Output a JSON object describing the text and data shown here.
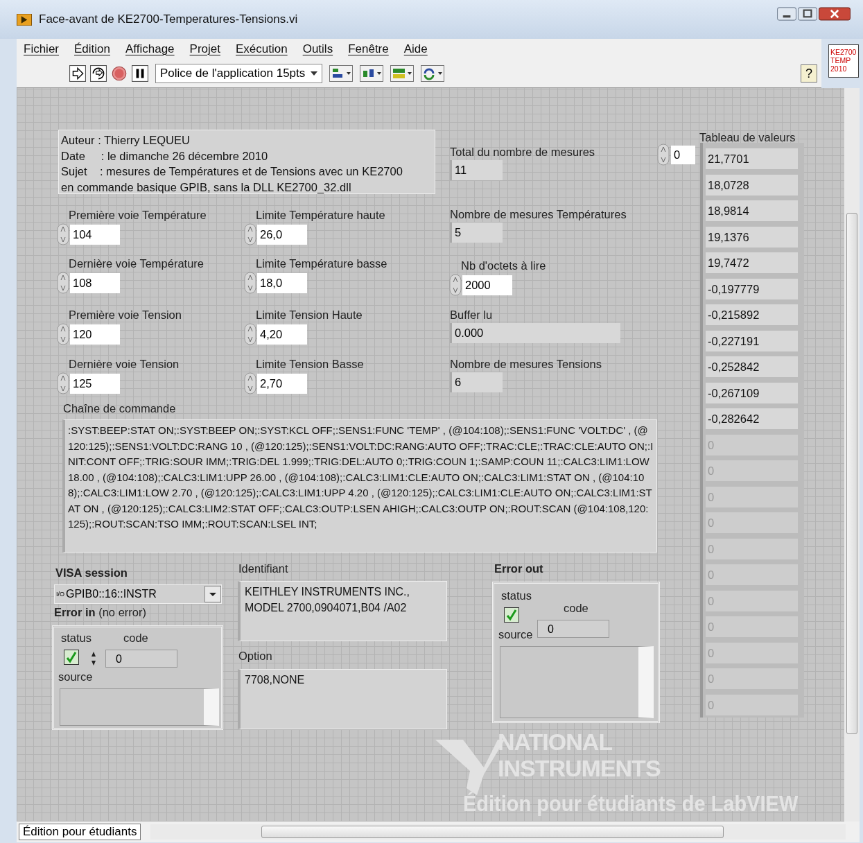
{
  "window": {
    "title": "Face-avant de KE2700-Temperatures-Tensions.vi"
  },
  "menu": [
    "Fichier",
    "Édition",
    "Affichage",
    "Projet",
    "Exécution",
    "Outils",
    "Fenêtre",
    "Aide"
  ],
  "toolbar": {
    "font": "Police de l'application 15pts",
    "help": "?",
    "vi_icon": [
      "KE2700",
      "TEMP",
      "2010"
    ]
  },
  "comment": [
    "Auteur : Thierry LEQUEU",
    "Date     : le dimanche 26 décembre 2010",
    "Sujet    : mesures de Températures et de Tensions avec un KE2700",
    "en commande basique GPIB, sans la DLL KE2700_32.dll"
  ],
  "numerics": [
    {
      "label": "Première voie Température",
      "value": "104",
      "kind": "control"
    },
    {
      "label": "Dernière voie Température",
      "value": "108",
      "kind": "control"
    },
    {
      "label": "Première voie Tension",
      "value": "120",
      "kind": "control"
    },
    {
      "label": "Dernière voie Tension",
      "value": "125",
      "kind": "control"
    },
    {
      "label": "Limite Température haute",
      "value": "26,0",
      "kind": "control"
    },
    {
      "label": "Limite Température basse",
      "value": "18,0",
      "kind": "control"
    },
    {
      "label": "Limite Tension Haute",
      "value": "4,20",
      "kind": "control"
    },
    {
      "label": "Limite Tension Basse",
      "value": "2,70",
      "kind": "control"
    },
    {
      "label": "Total du nombre de mesures",
      "value": "11",
      "kind": "indicator"
    },
    {
      "label": "Nombre de mesures Températures",
      "value": "5",
      "kind": "indicator"
    },
    {
      "label": "Nb d'octets à lire",
      "value": "2000",
      "kind": "control"
    },
    {
      "label": "Buffer lu",
      "value": "0.000",
      "kind": "string"
    },
    {
      "label": "Nombre de mesures Tensions",
      "value": "6",
      "kind": "indicator"
    }
  ],
  "array": {
    "label": "Tableau de valeurs",
    "index": "0",
    "items": [
      {
        "value": "21,7701",
        "disabled": false
      },
      {
        "value": "18,0728",
        "disabled": false
      },
      {
        "value": "18,9814",
        "disabled": false
      },
      {
        "value": "19,1376",
        "disabled": false
      },
      {
        "value": "19,7472",
        "disabled": false
      },
      {
        "value": "-0,197779",
        "disabled": false
      },
      {
        "value": "-0,215892",
        "disabled": false
      },
      {
        "value": "-0,227191",
        "disabled": false
      },
      {
        "value": "-0,252842",
        "disabled": false
      },
      {
        "value": "-0,267109",
        "disabled": false
      },
      {
        "value": "-0,282642",
        "disabled": false
      },
      {
        "value": "0",
        "disabled": true
      },
      {
        "value": "0",
        "disabled": true
      },
      {
        "value": "0",
        "disabled": true
      },
      {
        "value": "0",
        "disabled": true
      },
      {
        "value": "0",
        "disabled": true
      },
      {
        "value": "0",
        "disabled": true
      },
      {
        "value": "0",
        "disabled": true
      },
      {
        "value": "0",
        "disabled": true
      },
      {
        "value": "0",
        "disabled": true
      },
      {
        "value": "0",
        "disabled": true
      },
      {
        "value": "0",
        "disabled": true
      }
    ]
  },
  "command": {
    "label": "Chaîne de commande",
    "value": ":SYST:BEEP:STAT ON;:SYST:BEEP ON;:SYST:KCL OFF;:SENS1:FUNC 'TEMP' , (@104:108);:SENS1:FUNC 'VOLT:DC' , (@120:125);:SENS1:VOLT:DC:RANG 10 , (@120:125);:SENS1:VOLT:DC:RANG:AUTO OFF;:TRAC:CLE;:TRAC:CLE:AUTO ON;:INIT:CONT OFF;:TRIG:SOUR IMM;:TRIG:DEL 1.999;:TRIG:DEL:AUTO 0;:TRIG:COUN 1;:SAMP:COUN 11;:CALC3:LIM1:LOW 18.00 , (@104:108);:CALC3:LIM1:UPP 26.00 , (@104:108);:CALC3:LIM1:CLE:AUTO ON;:CALC3:LIM1:STAT ON , (@104:108);:CALC3:LIM1:LOW 2.70 , (@120:125);:CALC3:LIM1:UPP 4.20 , (@120:125);:CALC3:LIM1:CLE:AUTO ON;:CALC3:LIM1:STAT ON , (@120:125);:CALC3:LIM2:STAT OFF;:CALC3:OUTP:LSEN AHIGH;:CALC3:OUTP ON;:ROUT:SCAN (@104:108,120:125);:ROUT:SCAN:TSO IMM;:ROUT:SCAN:LSEL INT;"
  },
  "visa": {
    "label": "VISA session",
    "io_tag": "I/O",
    "value": "GPIB0::16::INSTR"
  },
  "error_in": {
    "label": "Error in",
    "note": "(no error)",
    "status_label": "status",
    "status": true,
    "code_label": "code",
    "code": "0",
    "source_label": "source"
  },
  "identifiant": {
    "label": "Identifiant",
    "value": "KEITHLEY INSTRUMENTS INC., MODEL 2700,0904071,B04   /A02"
  },
  "option": {
    "label": "Option",
    "value": "7708,NONE"
  },
  "error_out": {
    "label": "Error out",
    "status_label": "status",
    "status": true,
    "code_label": "code",
    "code": "0",
    "source_label": "source"
  },
  "watermark": [
    "NATIONAL",
    "INSTRUMENTS",
    "Édition pour étudiants de LabVIEW"
  ],
  "status_bar": "Édition pour étudiants"
}
